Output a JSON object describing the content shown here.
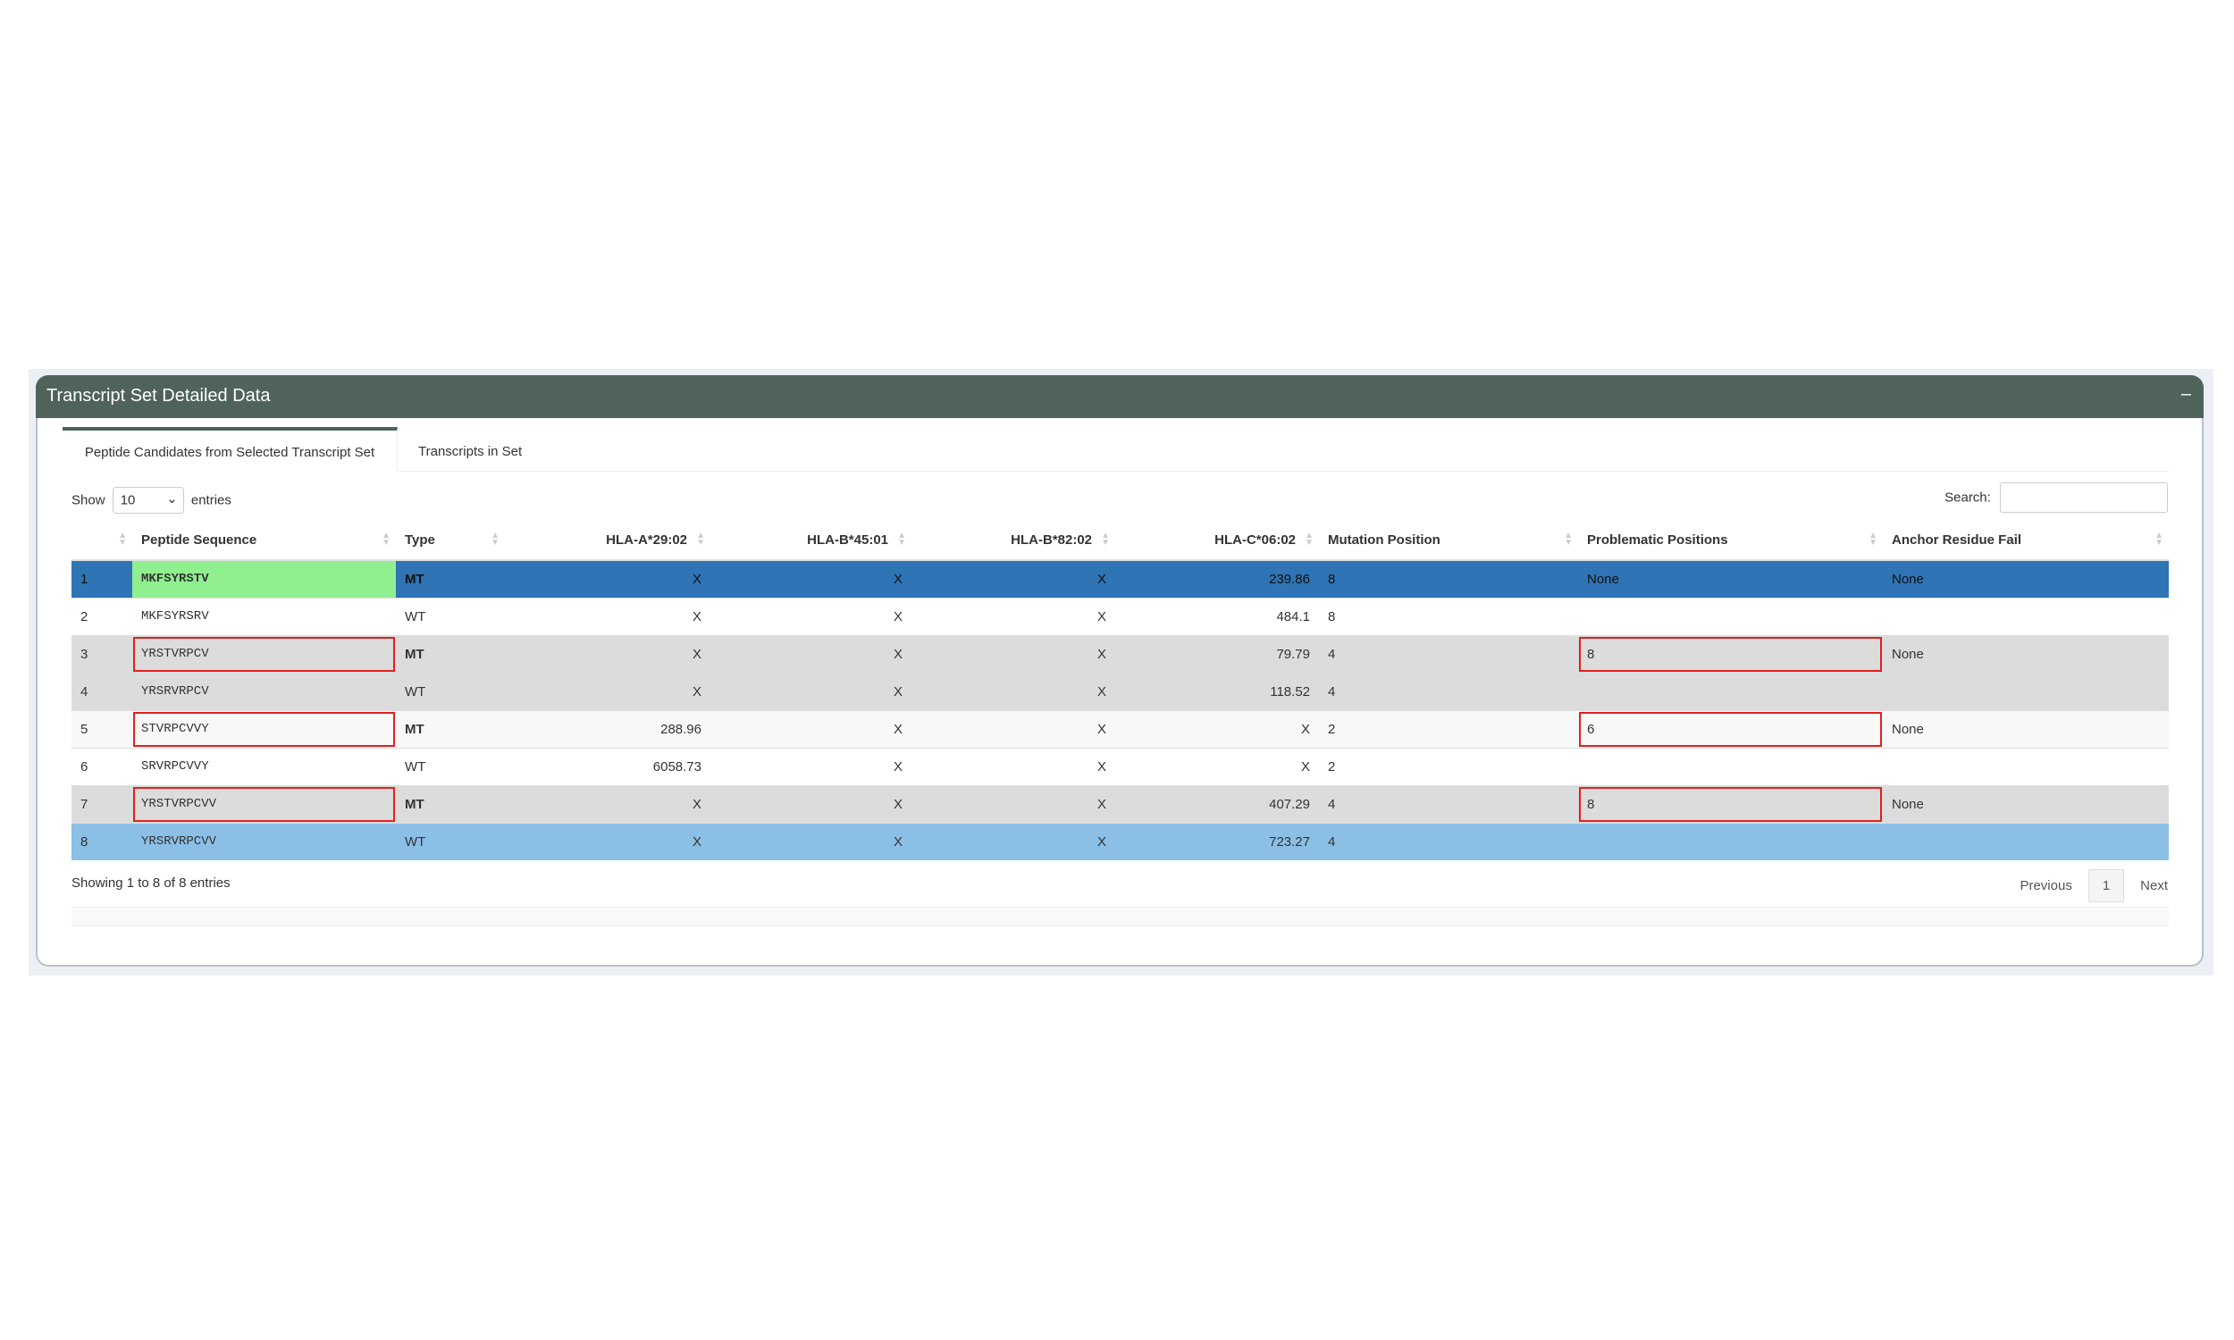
{
  "panel": {
    "title": "Transcript Set Detailed Data",
    "collapse_label": "–"
  },
  "tabs": [
    {
      "label": "Peptide Candidates from Selected Transcript Set",
      "active": true
    },
    {
      "label": "Transcripts in Set",
      "active": false
    }
  ],
  "length_menu": {
    "show": "Show",
    "value": "10",
    "entries": "entries"
  },
  "search": {
    "label": "Search:",
    "value": ""
  },
  "columns": [
    "",
    "Peptide Sequence",
    "Type",
    "HLA-A*29:02",
    "HLA-B*45:01",
    "HLA-B*82:02",
    "HLA-C*06:02",
    "Mutation Position",
    "Problematic Positions",
    "Anchor Residue Fail"
  ],
  "rows": [
    [
      "1",
      "MKFSYRSTV",
      "MT",
      "X",
      "X",
      "X",
      "239.86",
      "8",
      "None",
      "None"
    ],
    [
      "2",
      "MKFSYRSRV",
      "WT",
      "X",
      "X",
      "X",
      "484.1",
      "8",
      "",
      ""
    ],
    [
      "3",
      "YRSTVRPCV",
      "MT",
      "X",
      "X",
      "X",
      "79.79",
      "4",
      "8",
      "None"
    ],
    [
      "4",
      "YRSRVRPCV",
      "WT",
      "X",
      "X",
      "X",
      "118.52",
      "4",
      "",
      ""
    ],
    [
      "5",
      "STVRPCVVY",
      "MT",
      "288.96",
      "X",
      "X",
      "X",
      "2",
      "6",
      "None"
    ],
    [
      "6",
      "SRVRPCVVY",
      "WT",
      "6058.73",
      "X",
      "X",
      "X",
      "2",
      "",
      ""
    ],
    [
      "7",
      "YRSTVRPCVV",
      "MT",
      "X",
      "X",
      "X",
      "407.29",
      "4",
      "8",
      "None"
    ],
    [
      "8",
      "YRSRVRPCVV",
      "WT",
      "X",
      "X",
      "X",
      "723.27",
      "4",
      "",
      ""
    ]
  ],
  "info": "Showing 1 to 8 of 8 entries",
  "pagination": {
    "previous": "Previous",
    "current": "1",
    "next": "Next"
  },
  "colors": {
    "header": "#4f635a",
    "selected": "#2f74b5",
    "highlight_row": "#8bbfe6",
    "mt_cell": "#90f090",
    "flag_border": "#e02020"
  }
}
